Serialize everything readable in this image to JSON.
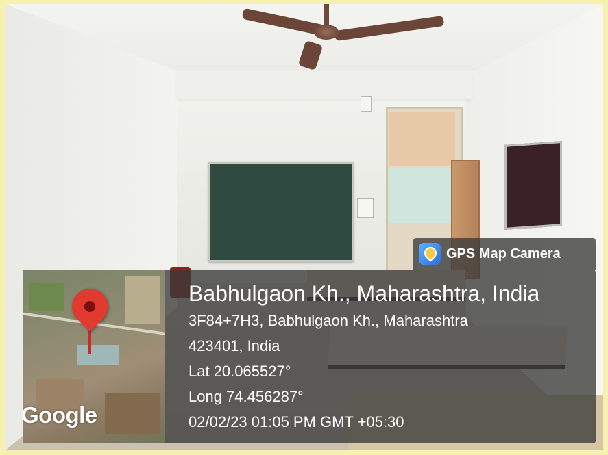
{
  "overlay": {
    "app_name": "GPS Map Camera",
    "app_icon": "gps-map-camera-app-icon",
    "location_title": "Babhulgaon Kh., Maharashtra, India",
    "address_line_1": "3F84+7H3, Babhulgaon Kh., Maharashtra",
    "address_line_2": "423401, India",
    "latitude": "Lat 20.065527°",
    "longitude": "Long 74.456287°",
    "timestamp": "02/02/23 01:05 PM GMT +05:30",
    "map_watermark": "Google",
    "map_pin_icon": "location-pin-icon",
    "panel_color": "#3a3a3a"
  }
}
